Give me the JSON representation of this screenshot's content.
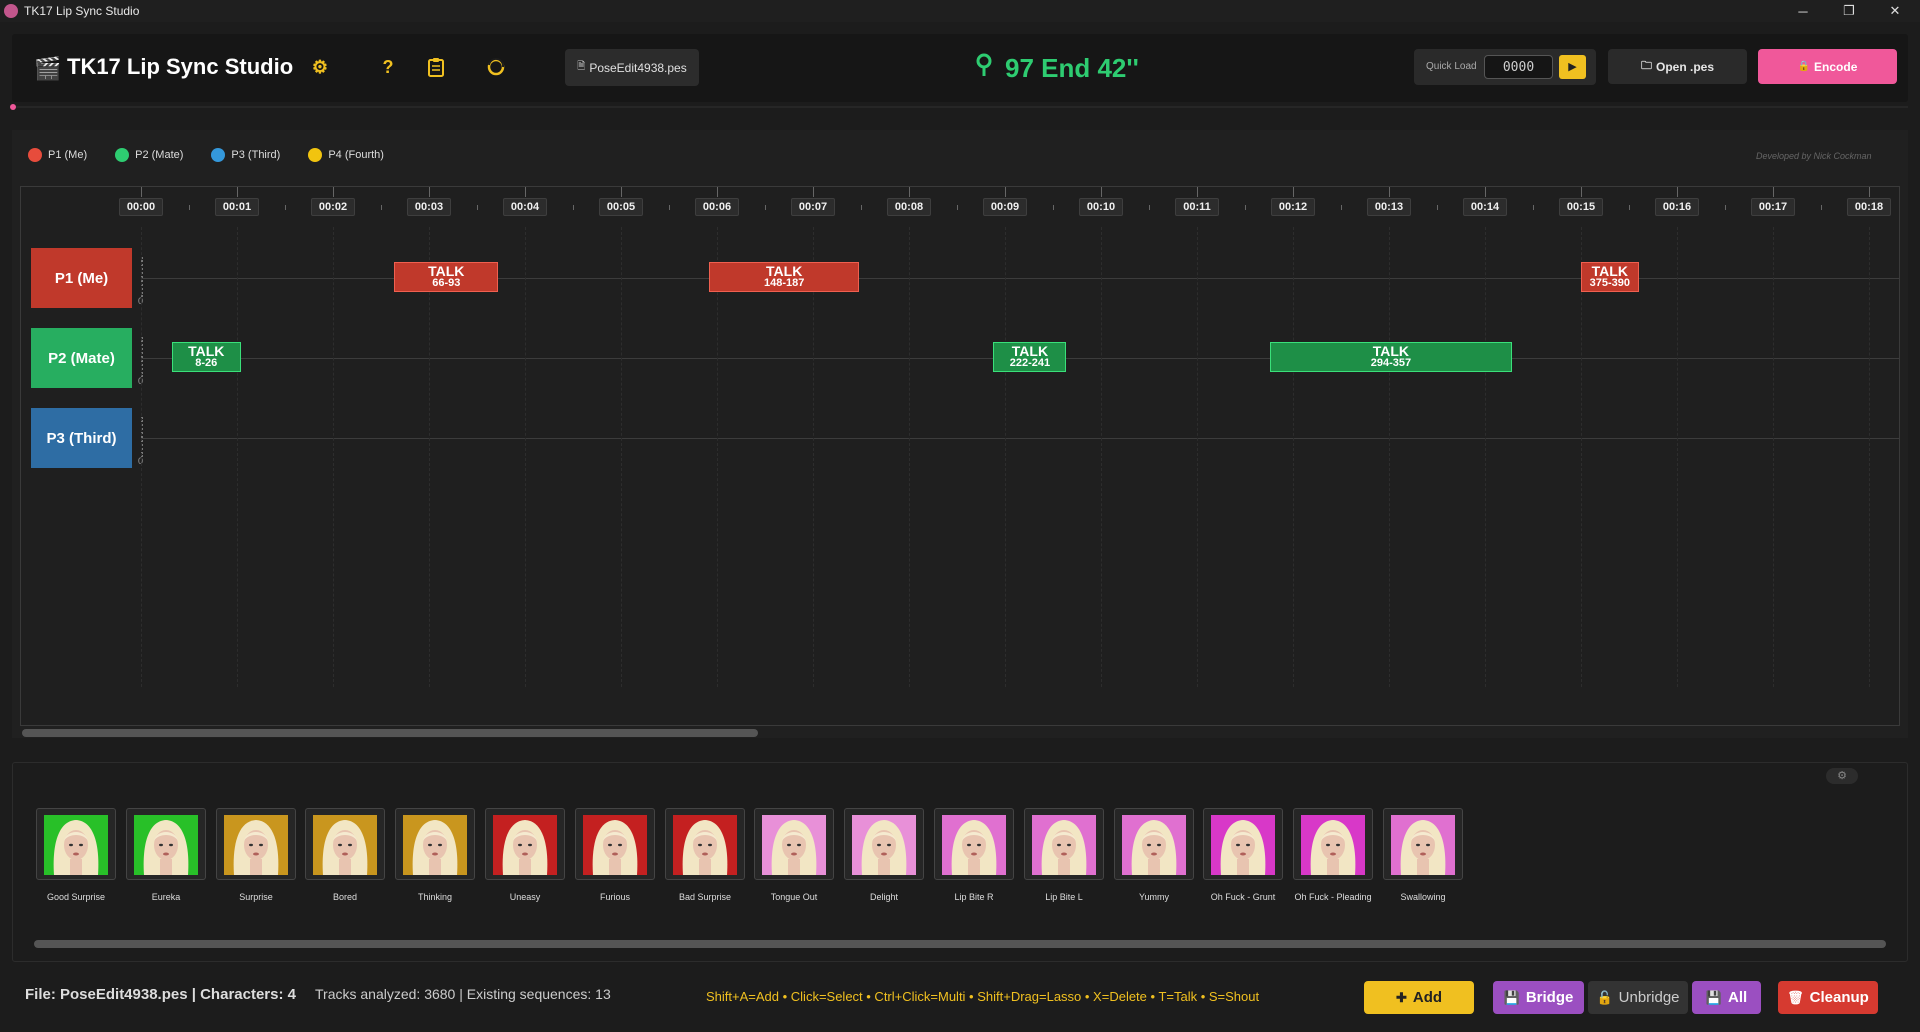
{
  "window": {
    "title": "TK17 Lip Sync Studio",
    "minimize": "─",
    "restore": "❐",
    "close": "✕"
  },
  "header": {
    "app_title": "TK17 Lip Sync Studio",
    "file_name": "PoseEdit4938.pes",
    "pose_status": "97 End 42''",
    "quick_load_label": "Quick Load",
    "quick_load_value": "0000",
    "quick_load_go": "▶",
    "open_label": "Open .pes",
    "encode_label": "Encode",
    "icons": [
      "clapperboard-icon",
      "settings-icon",
      "help-icon",
      "clipboard-icon",
      "refresh-icon"
    ]
  },
  "legend": {
    "items": [
      {
        "label": "P1 (Me)",
        "color": "#e74c3c"
      },
      {
        "label": "P2 (Mate)",
        "color": "#2ecc71"
      },
      {
        "label": "P3 (Third)",
        "color": "#3498db"
      },
      {
        "label": "P4 (Fourth)",
        "color": "#f1c40f"
      }
    ],
    "credit": "Developed by Nick Cockman"
  },
  "timeline": {
    "ruler": [
      "00:00",
      "00:01",
      "00:02",
      "00:03",
      "00:04",
      "00:05",
      "00:06",
      "00:07",
      "00:08",
      "00:09",
      "00:10",
      "00:11",
      "00:12",
      "00:13",
      "00:14",
      "00:15",
      "00:16",
      "00:17",
      "00:18"
    ],
    "tracks": [
      {
        "label": "P1 (Me)",
        "color": "#c0392b",
        "zero": "0"
      },
      {
        "label": "P2 (Mate)",
        "color": "#27ae60",
        "zero": "0"
      },
      {
        "label": "P3 (Third)",
        "color": "#2e6da4",
        "zero": "0"
      }
    ],
    "clips": [
      {
        "track": 0,
        "title": "TALK",
        "range": "66-93",
        "start": 66,
        "end": 93
      },
      {
        "track": 0,
        "title": "TALK",
        "range": "148-187",
        "start": 148,
        "end": 187
      },
      {
        "track": 0,
        "title": "TALK",
        "range": "375-390",
        "start": 375,
        "end": 390
      },
      {
        "track": 1,
        "title": "TALK",
        "range": "8-26",
        "start": 8,
        "end": 26
      },
      {
        "track": 1,
        "title": "TALK",
        "range": "222-241",
        "start": 222,
        "end": 241
      },
      {
        "track": 1,
        "title": "TALK",
        "range": "294-357",
        "start": 294,
        "end": 357
      }
    ]
  },
  "expressions": [
    {
      "label": "Good Surprise",
      "bg": "#28c028"
    },
    {
      "label": "Eureka",
      "bg": "#28c028"
    },
    {
      "label": "Surprise",
      "bg": "#c9961e"
    },
    {
      "label": "Bored",
      "bg": "#c9961e"
    },
    {
      "label": "Thinking",
      "bg": "#c9961e"
    },
    {
      "label": "Uneasy",
      "bg": "#c42020"
    },
    {
      "label": "Furious",
      "bg": "#c42020"
    },
    {
      "label": "Bad Surprise",
      "bg": "#c42020"
    },
    {
      "label": "Tongue Out",
      "bg": "#e890d8"
    },
    {
      "label": "Delight",
      "bg": "#e890d8"
    },
    {
      "label": "Lip Bite R",
      "bg": "#e070d0"
    },
    {
      "label": "Lip Bite L",
      "bg": "#e070d0"
    },
    {
      "label": "Yummy",
      "bg": "#e070d0"
    },
    {
      "label": "Oh Fuck - Grunt",
      "bg": "#d838c8"
    },
    {
      "label": "Oh Fuck - Pleading",
      "bg": "#d838c8"
    },
    {
      "label": "Swallowing",
      "bg": "#e070d0"
    }
  ],
  "status": {
    "file_info": "File: PoseEdit4938.pes | Characters: 4",
    "tracks_info": "Tracks analyzed: 3680 | Existing sequences: 13",
    "hints": "Shift+A=Add • Click=Select • Ctrl+Click=Multi • Shift+Drag=Lasso • X=Delete • T=Talk • S=Shout",
    "add_label": "Add",
    "bridge_label": "Bridge",
    "unbridge_label": "Unbridge",
    "all_label": "All",
    "cleanup_label": "Cleanup"
  }
}
